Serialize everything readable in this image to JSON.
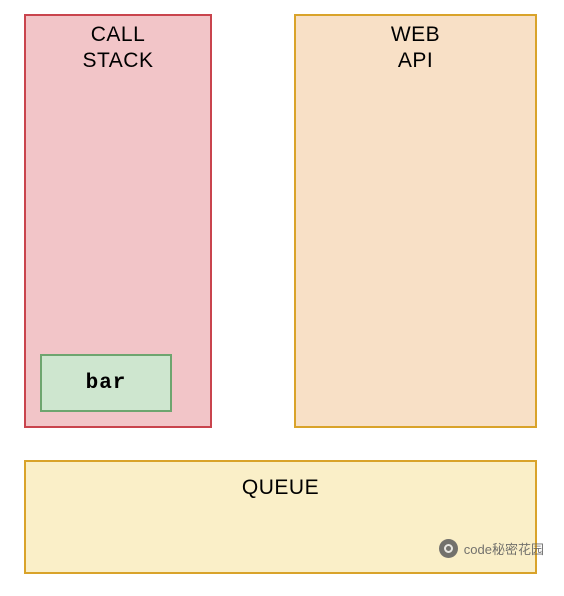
{
  "callStack": {
    "title_line1": "CALL",
    "title_line2": "STACK",
    "frames": [
      {
        "label": "bar"
      }
    ]
  },
  "webApi": {
    "title_line1": "WEB",
    "title_line2": "API"
  },
  "queue": {
    "title": "QUEUE"
  },
  "watermark": {
    "text": "code秘密花园"
  }
}
